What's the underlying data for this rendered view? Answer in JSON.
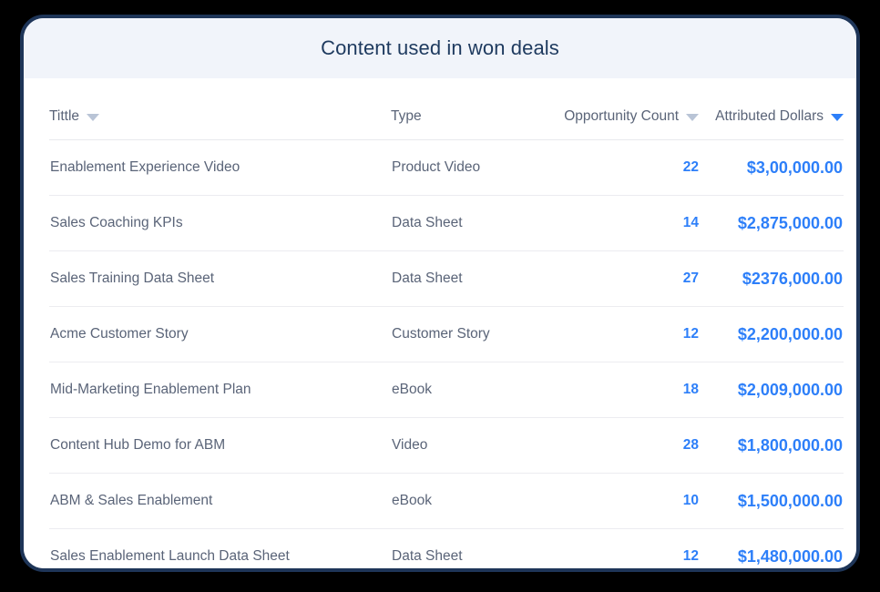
{
  "card": {
    "title": "Content used in won deals"
  },
  "colors": {
    "accent_blue": "#2d7ff9",
    "title_navy": "#1e3a5f",
    "border_navy": "#1e3558",
    "header_band": "#f1f4fa",
    "text_gray": "#5a6478",
    "caret_gray": "#b9c4d6",
    "row_divider": "#ececf0",
    "page_background": "#000000"
  },
  "table": {
    "columns": [
      {
        "key": "title",
        "label": "Tittle",
        "sortable": true,
        "sort_active": false,
        "align": "left"
      },
      {
        "key": "type",
        "label": "Type",
        "sortable": false,
        "sort_active": false,
        "align": "left"
      },
      {
        "key": "count",
        "label": "Opportunity Count",
        "sortable": true,
        "sort_active": false,
        "align": "right"
      },
      {
        "key": "dollars",
        "label": "Attributed Dollars",
        "sortable": true,
        "sort_active": true,
        "align": "right"
      }
    ],
    "rows": [
      {
        "title": "Enablement Experience Video",
        "type": "Product Video",
        "count": "22",
        "dollars": "$3,00,000.00"
      },
      {
        "title": "Sales Coaching KPIs",
        "type": "Data Sheet",
        "count": "14",
        "dollars": "$2,875,000.00"
      },
      {
        "title": "Sales Training Data Sheet",
        "type": "Data Sheet",
        "count": "27",
        "dollars": "$2376,000.00"
      },
      {
        "title": "Acme Customer Story",
        "type": "Customer Story",
        "count": "12",
        "dollars": "$2,200,000.00"
      },
      {
        "title": "Mid-Marketing Enablement Plan",
        "type": "eBook",
        "count": "18",
        "dollars": "$2,009,000.00"
      },
      {
        "title": "Content Hub Demo for ABM",
        "type": "Video",
        "count": "28",
        "dollars": "$1,800,000.00"
      },
      {
        "title": "ABM & Sales Enablement",
        "type": "eBook",
        "count": "10",
        "dollars": "$1,500,000.00"
      },
      {
        "title": "Sales Enablement Launch Data Sheet",
        "type": "Data Sheet",
        "count": "12",
        "dollars": "$1,480,000.00"
      }
    ]
  },
  "icons": {
    "sort_caret": "chevron-down-icon"
  }
}
